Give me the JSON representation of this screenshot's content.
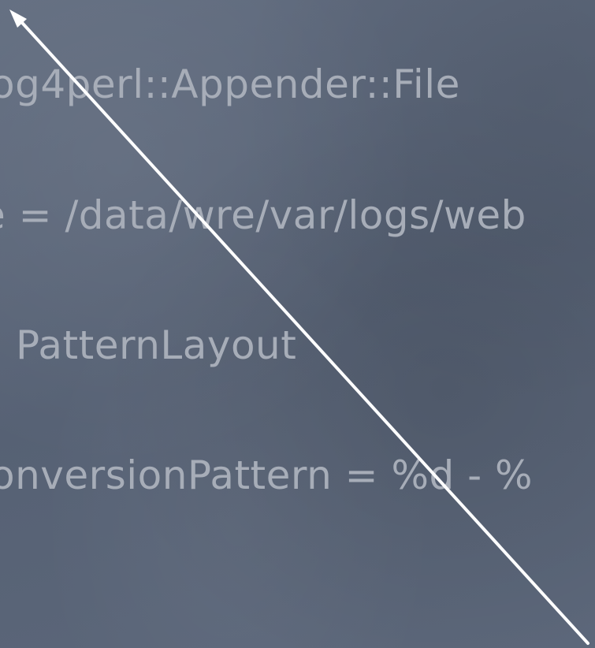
{
  "slide": {
    "lines": [
      "og4perl::Appender::File",
      "e = /data/wre/var/logs/web",
      "PatternLayout",
      "onversionPattern = %d - %"
    ]
  },
  "colors": {
    "background": "#5a6578",
    "text": "#a7adb8",
    "arrow": "#ffffff"
  },
  "icons": {
    "arrow": "diagonal-arrow-icon"
  }
}
